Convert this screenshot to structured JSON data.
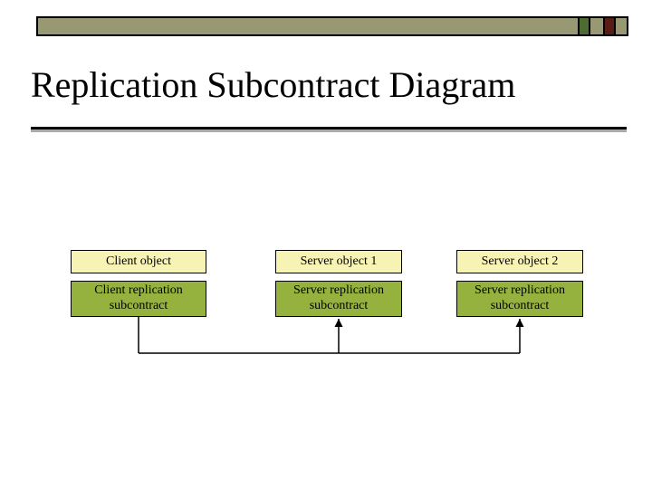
{
  "title": "Replication Subcontract Diagram",
  "boxes": {
    "client_object": "Client object",
    "client_sub": "Client replication\nsubcontract",
    "server_object_1": "Server object 1",
    "server_sub_1": "Server replication\nsubcontract",
    "server_object_2": "Server object 2",
    "server_sub_2": "Server replication\nsubcontract"
  }
}
